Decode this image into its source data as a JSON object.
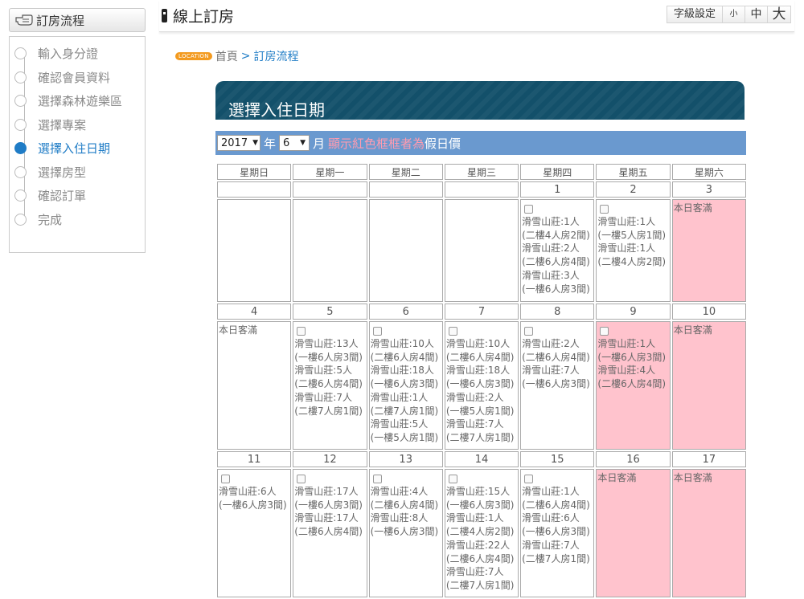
{
  "sidebar": {
    "title": "訂房流程",
    "steps": [
      {
        "label": "輸入身分證",
        "active": false
      },
      {
        "label": "確認會員資料",
        "active": false
      },
      {
        "label": "選擇森林遊樂區",
        "active": false
      },
      {
        "label": "選擇專案",
        "active": false
      },
      {
        "label": "選擇入住日期",
        "active": true
      },
      {
        "label": "選擇房型",
        "active": false
      },
      {
        "label": "確認訂單",
        "active": false
      },
      {
        "label": "完成",
        "active": false
      }
    ]
  },
  "header": {
    "title": "線上訂房",
    "font_label": "字級設定",
    "sizes": [
      "小",
      "中",
      "大"
    ]
  },
  "breadcrumb": {
    "badge": "LOCATION",
    "home": "首頁",
    "sep": ">",
    "current": "訂房流程"
  },
  "panel": {
    "title": "選擇入住日期"
  },
  "filter": {
    "year": "2017",
    "year_unit": "年",
    "month": "6",
    "month_unit": "月",
    "note_red": "顯示紅色框框者為",
    "note_white": "假日價"
  },
  "calendar": {
    "weekdays": [
      "星期日",
      "星期一",
      "星期二",
      "星期三",
      "星期四",
      "星期五",
      "星期六"
    ],
    "full_text": "本日客滿",
    "weeks": [
      [
        null,
        null,
        null,
        null,
        {
          "day": "1",
          "checkbox": true,
          "lines": [
            "滑雪山莊:1人",
            "(二樓4人房2間)",
            "滑雪山莊:2人",
            "(二樓6人房4間)",
            "滑雪山莊:3人",
            "(一樓6人房3間)"
          ]
        },
        {
          "day": "2",
          "checkbox": true,
          "lines": [
            "滑雪山莊:1人",
            "(一樓5人房1間)",
            "滑雪山莊:1人",
            "(二樓4人房2間)"
          ]
        },
        {
          "day": "3",
          "full": true,
          "lines": []
        }
      ],
      [
        {
          "day": "4",
          "fulltext": true,
          "lines": []
        },
        {
          "day": "5",
          "checkbox": true,
          "lines": [
            "滑雪山莊:13人",
            "(一樓6人房3間)",
            "滑雪山莊:5人",
            "(二樓6人房4間)",
            "滑雪山莊:7人",
            "(二樓7人房1間)"
          ]
        },
        {
          "day": "6",
          "checkbox": true,
          "lines": [
            "滑雪山莊:10人",
            "(二樓6人房4間)",
            "滑雪山莊:18人",
            "(一樓6人房3間)",
            "滑雪山莊:1人",
            "(二樓7人房1間)",
            "滑雪山莊:5人",
            "(一樓5人房1間)"
          ]
        },
        {
          "day": "7",
          "checkbox": true,
          "lines": [
            "滑雪山莊:10人",
            "(二樓6人房4間)",
            "滑雪山莊:18人",
            "(一樓6人房3間)",
            "滑雪山莊:2人",
            "(一樓5人房1間)",
            "滑雪山莊:7人",
            "(二樓7人房1間)"
          ]
        },
        {
          "day": "8",
          "checkbox": true,
          "lines": [
            "滑雪山莊:2人",
            "(二樓6人房4間)",
            "滑雪山莊:7人",
            "(一樓6人房3間)"
          ]
        },
        {
          "day": "9",
          "checkbox": true,
          "holiday": true,
          "lines": [
            "滑雪山莊:1人",
            "(一樓6人房3間)",
            "滑雪山莊:4人",
            "(二樓6人房4間)"
          ]
        },
        {
          "day": "10",
          "full": true,
          "lines": []
        }
      ],
      [
        {
          "day": "11",
          "checkbox": true,
          "lines": [
            "滑雪山莊:6人",
            "(一樓6人房3間)"
          ]
        },
        {
          "day": "12",
          "checkbox": true,
          "lines": [
            "滑雪山莊:17人",
            "(一樓6人房3間)",
            "滑雪山莊:17人",
            "(二樓6人房4間)"
          ]
        },
        {
          "day": "13",
          "checkbox": true,
          "lines": [
            "滑雪山莊:4人",
            "(二樓6人房4間)",
            "滑雪山莊:8人",
            "(一樓6人房3間)"
          ]
        },
        {
          "day": "14",
          "checkbox": true,
          "lines": [
            "滑雪山莊:15人",
            "(一樓6人房3間)",
            "滑雪山莊:1人",
            "(二樓4人房2間)",
            "滑雪山莊:22人",
            "(二樓6人房4間)",
            "滑雪山莊:7人",
            "(二樓7人房1間)"
          ]
        },
        {
          "day": "15",
          "checkbox": true,
          "lines": [
            "滑雪山莊:1人",
            "(二樓6人房4間)",
            "滑雪山莊:6人",
            "(一樓6人房3間)",
            "滑雪山莊:7人",
            "(二樓7人房1間)"
          ]
        },
        {
          "day": "16",
          "full": true,
          "lines": []
        },
        {
          "day": "17",
          "full": true,
          "lines": []
        }
      ]
    ]
  }
}
